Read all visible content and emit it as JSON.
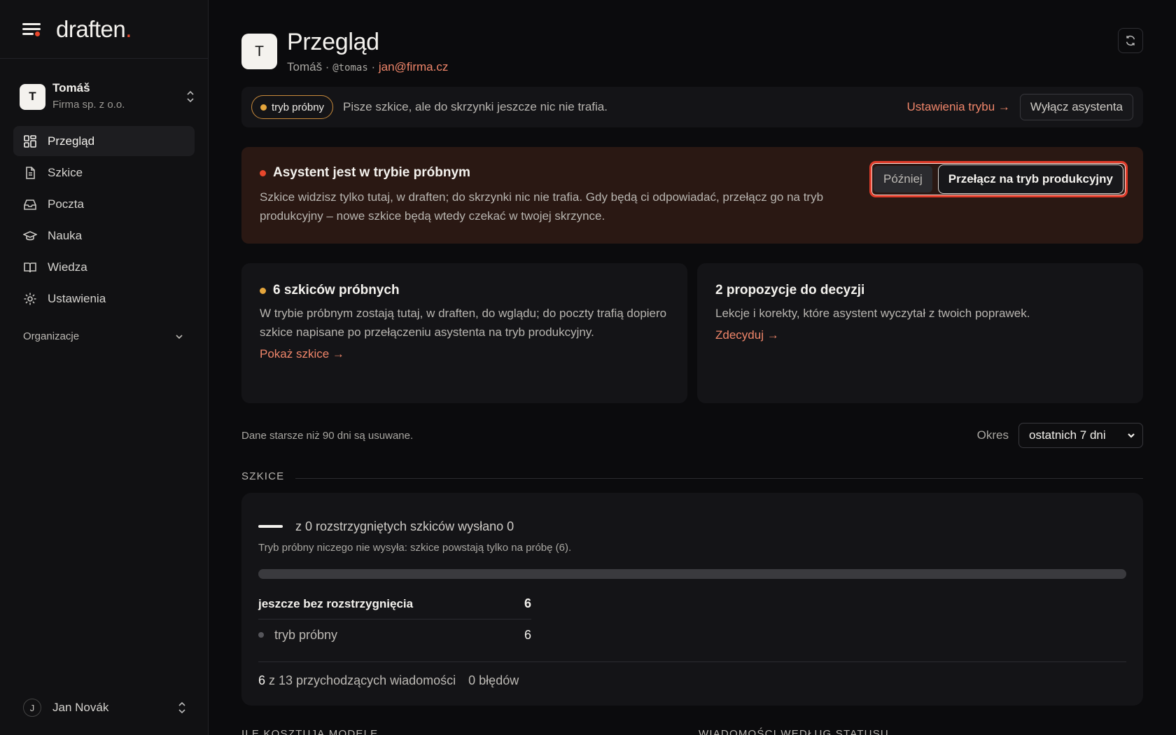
{
  "brand": {
    "logo_text": "draften",
    "logo_dot": ".",
    "accent": "#e8472c"
  },
  "org": {
    "avatar": "T",
    "name": "Tomáš",
    "subtitle": "Firma sp. z o.o."
  },
  "nav": [
    {
      "label": "Przegląd",
      "icon": "dashboard-icon",
      "active": true
    },
    {
      "label": "Szkice",
      "icon": "document-icon",
      "active": false
    },
    {
      "label": "Poczta",
      "icon": "inbox-icon",
      "active": false
    },
    {
      "label": "Nauka",
      "icon": "graduation-cap-icon",
      "active": false
    },
    {
      "label": "Wiedza",
      "icon": "book-icon",
      "active": false
    },
    {
      "label": "Ustawienia",
      "icon": "gear-icon",
      "active": false
    }
  ],
  "org_section": {
    "label": "Organizacje"
  },
  "user": {
    "avatar": "J",
    "name": "Jan Novák"
  },
  "header": {
    "avatar": "T",
    "title": "Przegląd",
    "name": "Tomáš",
    "sep1": " · ",
    "handle": "@tomas",
    "sep2": " · ",
    "email": "jan@firma.cz"
  },
  "mode_bar": {
    "badge": "tryb próbny",
    "text": "Pisze szkice, ale do skrzynki jeszcze nic nie trafia.",
    "settings_link": "Ustawienia trybu →",
    "disable_button": "Wyłącz asystenta"
  },
  "warning": {
    "title": "Asystent jest w trybie próbnym",
    "text": "Szkice widzisz tylko tutaj, w draften; do skrzynki nic nie trafia. Gdy będą ci odpowiadać, przełącz go na tryb produkcyjny – nowe szkice będą wtedy czekać w twojej skrzynce.",
    "later_button": "Później",
    "switch_button": "Przełącz na tryb produkcyjny"
  },
  "cards": [
    {
      "title": "6 szkiców próbnych",
      "text": "W trybie próbnym zostają tutaj, w draften, do wglądu; do poczty trafią dopiero szkice napisane po przełączeniu asystenta na tryb produkcyjny.",
      "link": "Pokaż szkice →"
    },
    {
      "title": "2 propozycje do decyzji",
      "text": "Lekcje i korekty, które asystent wyczytał z twoich poprawek.",
      "link": "Zdecyduj →"
    }
  ],
  "retention": "Dane starsze niż 90 dni są usuwane.",
  "period": {
    "label": "Okres",
    "selected": "ostatnich 7 dni"
  },
  "drafts_section": {
    "heading": "SZKICE",
    "sent_text": "z 0 rozstrzygniętych szkiców wysłano 0",
    "note": "Tryb próbny niczego nie wysyła: szkice powstają tylko na próbę (6).",
    "progress_fraction": 0,
    "undecided_label": "jeszcze bez rozstrzygnięcia",
    "undecided_value": "6",
    "trial_label": "tryb próbny",
    "trial_value": "6",
    "incoming_count": "6",
    "incoming_text": "z 13 przychodzących wiadomości",
    "errors_text": "0 błędów"
  },
  "bottom_sections": {
    "left": "ILE KOSZTUJĄ MODELE",
    "right": "WIADOMOŚCI WEDŁUG STATUSU"
  }
}
